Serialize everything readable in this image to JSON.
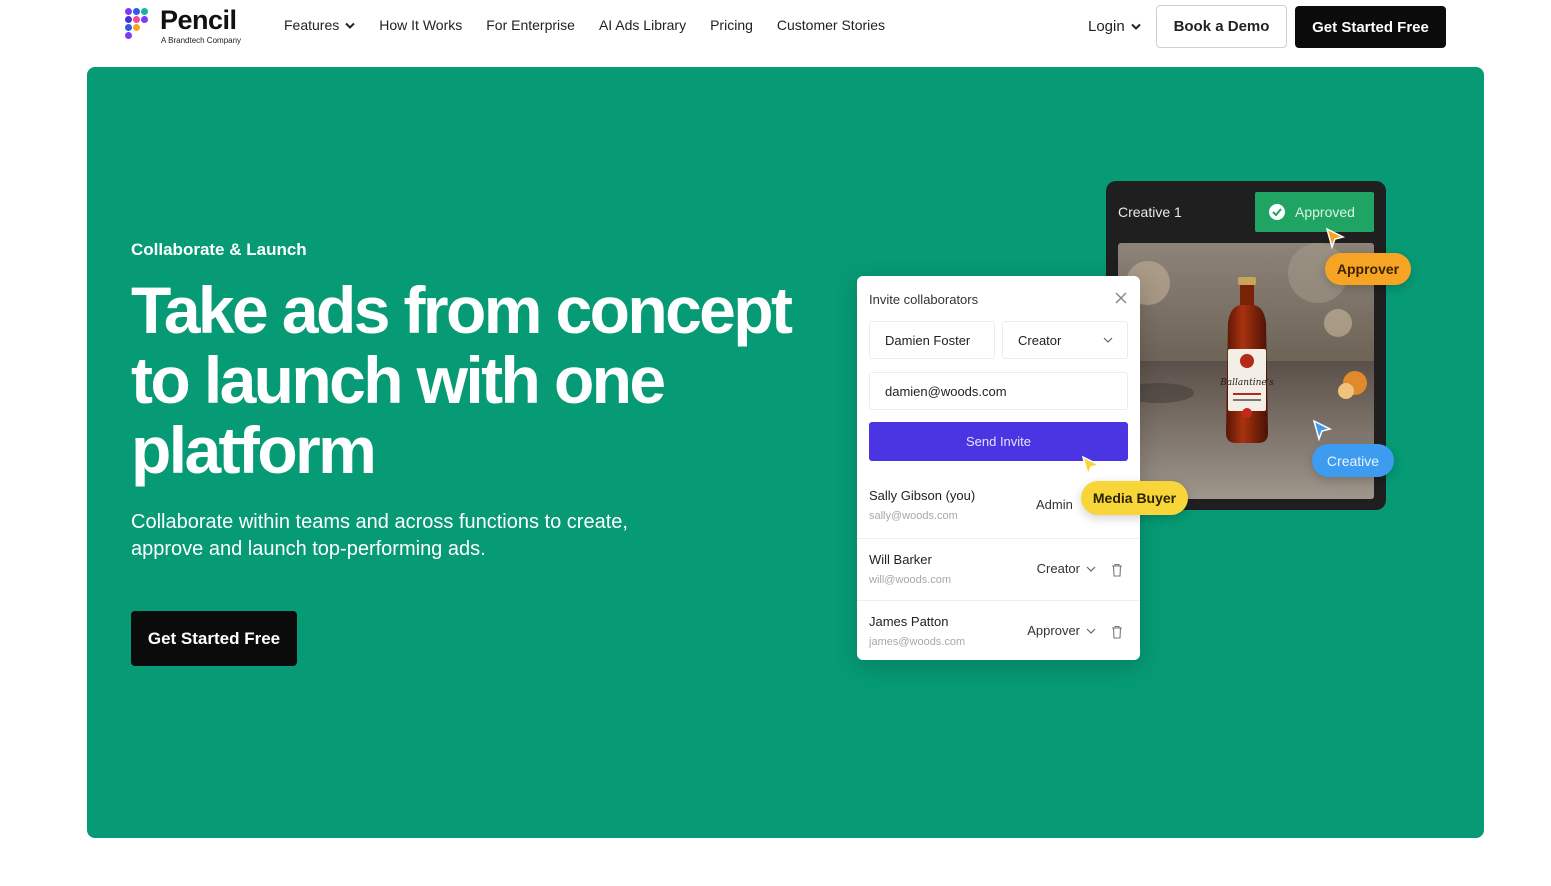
{
  "brand": {
    "name": "Pencil",
    "tagline": "A Brandtech Company",
    "dot_colors": [
      "#7a3cf0",
      "#2f5bea",
      "#16b3a0",
      "#e94b9b",
      "#f4a823",
      "#4b2fd6"
    ]
  },
  "nav": {
    "links": [
      {
        "label": "Features",
        "has_dropdown": true
      },
      {
        "label": "How It Works"
      },
      {
        "label": "For Enterprise"
      },
      {
        "label": "AI Ads Library"
      },
      {
        "label": "Pricing"
      },
      {
        "label": "Customer Stories"
      }
    ],
    "login_label": "Login",
    "demo_label": "Book a Demo",
    "start_label": "Get Started Free"
  },
  "hero": {
    "background_color": "#069a75",
    "eyebrow": "Collaborate & Launch",
    "headline": "Take ads from concept to launch with one platform",
    "subtext": "Collaborate within teams and across functions to create, approve and launch top-performing ads.",
    "cta_label": "Get Started Free"
  },
  "creative_card": {
    "title": "Creative 1",
    "approved_label": "Approved",
    "bottle_label": "Ballantine's"
  },
  "invite_modal": {
    "title": "Invite collaborators",
    "name_value": "Damien Foster",
    "role_value": "Creator",
    "email_value": "damien@woods.com",
    "send_label": "Send Invite",
    "members": [
      {
        "name": "Sally Gibson (you)",
        "email": "sally@woods.com",
        "role": "Admin"
      },
      {
        "name": "Will Barker",
        "email": "will@woods.com",
        "role": "Creator"
      },
      {
        "name": "James Patton",
        "email": "james@woods.com",
        "role": "Approver"
      }
    ]
  },
  "tags": {
    "approver": "Approver",
    "creative": "Creative",
    "media_buyer": "Media Buyer"
  }
}
